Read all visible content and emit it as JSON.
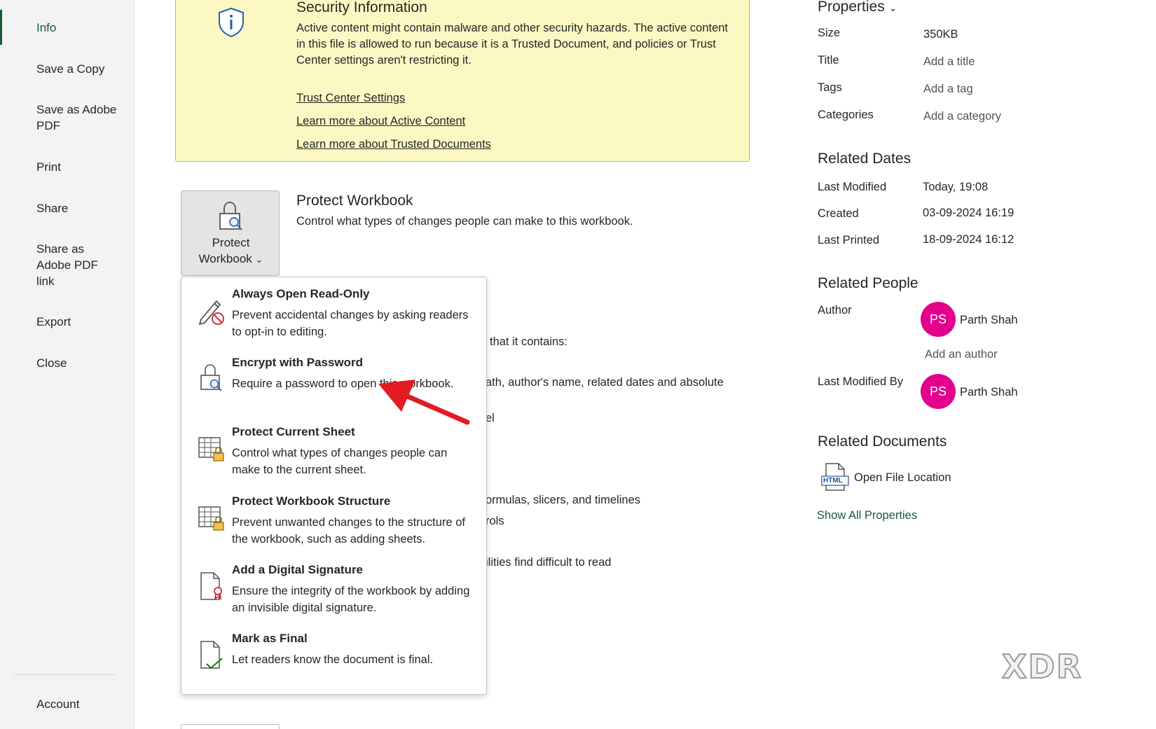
{
  "sidebar": {
    "items": [
      {
        "label": "Info"
      },
      {
        "label": "Save a Copy"
      },
      {
        "label": "Save as Adobe PDF"
      },
      {
        "label": "Print"
      },
      {
        "label": "Share"
      },
      {
        "label": "Share as Adobe PDF link"
      },
      {
        "label": "Export"
      },
      {
        "label": "Close"
      },
      {
        "label": "Account"
      }
    ]
  },
  "security": {
    "title": "Security Information",
    "text": "Active content might contain malware and other security hazards. The active content in this file is allowed to run because it is a Trusted Document, and policies or Trust Center settings aren't restricting it.",
    "links": [
      "Trust Center Settings",
      "Learn more about Active Content",
      "Learn more about Trusted Documents"
    ]
  },
  "protect": {
    "button_label_1": "Protect",
    "button_label_2": "Workbook",
    "chevron": "⌄",
    "title": "Protect Workbook",
    "description": "Control what types of changes people can make to this workbook."
  },
  "background_fragments": [
    "that it contains:",
    "ath, author's name, related dates and absolute",
    "el",
    "ormulas, slicers, and timelines",
    "rols",
    "ilities find difficult to read"
  ],
  "menu": {
    "items": [
      {
        "title": "Always Open Read-Only",
        "description": "Prevent accidental changes by asking readers to opt-in to editing.",
        "icon": "pencil-blocked-icon"
      },
      {
        "title": "Encrypt with Password",
        "description": "Require a password to open this workbook.",
        "icon": "lock-key-icon"
      },
      {
        "title": "Protect Current Sheet",
        "description": "Control what types of changes people can make to the current sheet.",
        "icon": "sheet-lock-icon"
      },
      {
        "title": "Protect Workbook Structure",
        "description": "Prevent unwanted changes to the structure of the workbook, such as adding sheets.",
        "icon": "workbook-lock-icon"
      },
      {
        "title": "Add a Digital Signature",
        "description": "Ensure the integrity of the workbook by adding an invisible digital signature.",
        "icon": "document-ribbon-icon"
      },
      {
        "title": "Mark as Final",
        "description": "Let readers know the document is final.",
        "icon": "document-check-icon"
      }
    ]
  },
  "properties": {
    "heading": "Properties",
    "chevron": "⌄",
    "rows": [
      {
        "label": "Size",
        "value": "350KB"
      },
      {
        "label": "Title",
        "value": "Add a title"
      },
      {
        "label": "Tags",
        "value": "Add a tag"
      },
      {
        "label": "Categories",
        "value": "Add a category"
      }
    ]
  },
  "related_dates": {
    "heading": "Related Dates",
    "rows": [
      {
        "label": "Last Modified",
        "value": "Today, 19:08"
      },
      {
        "label": "Created",
        "value": "03-09-2024 16:19"
      },
      {
        "label": "Last Printed",
        "value": "18-09-2024 16:12"
      }
    ]
  },
  "related_people": {
    "heading": "Related People",
    "author_label": "Author",
    "author_initials": "PS",
    "author_name": "Parth Shah",
    "add_author": "Add an author",
    "last_modified_by_label": "Last Modified By",
    "last_modified_initials": "PS",
    "last_modified_name": "Parth Shah",
    "avatar_color": "#e3008c"
  },
  "related_documents": {
    "heading": "Related Documents",
    "open_location": "Open File Location",
    "file_badge": "HTML",
    "show_all": "Show All Properties"
  },
  "colors": {
    "accent_green": "#185c37",
    "security_bg": "#fcf8c3",
    "arrow_red": "#e31b23"
  },
  "watermark": "XDR"
}
